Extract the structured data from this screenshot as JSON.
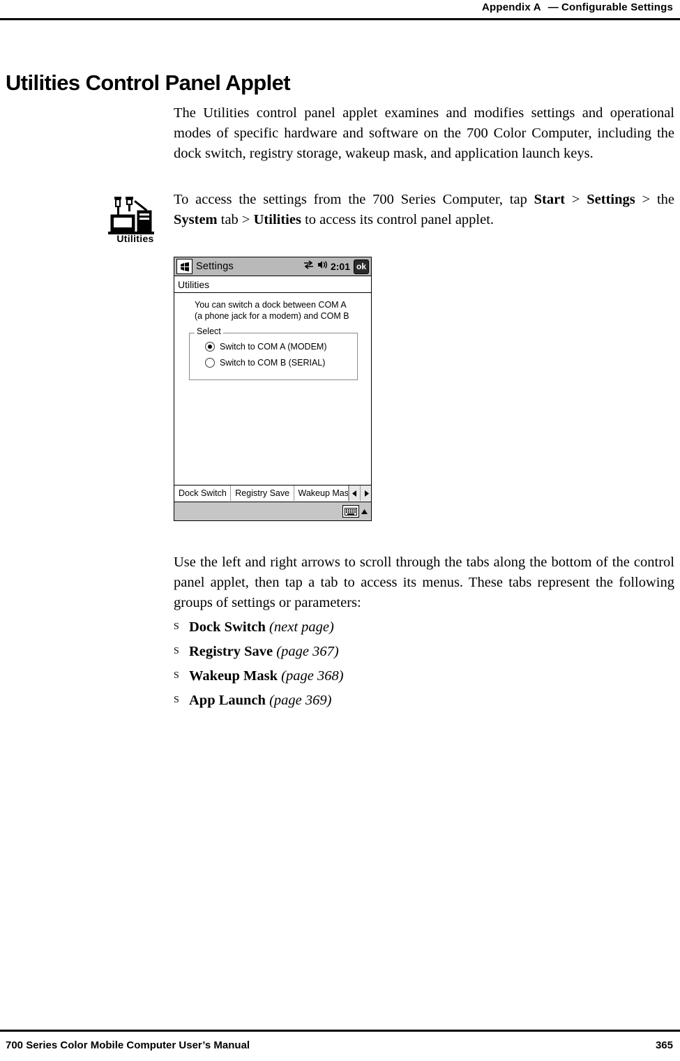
{
  "header": {
    "appendix": "Appendix A",
    "dash": "—",
    "section": "Configurable Settings"
  },
  "title": "Utilities Control Panel Applet",
  "paragraphs": {
    "intro": "The Utilities control panel applet examines and modifies settings and operational modes of specific hardware and software on the 700 Color Computer, including the dock switch, registry storage, wakeup mask, and application launch keys.",
    "access_prefix": "To access the settings from the 700 Series Computer, tap ",
    "access_start": "Start",
    "access_gt1": " > ",
    "access_settings": "Settings",
    "access_mid": " > the ",
    "access_system": "System",
    "access_tab": " tab > ",
    "access_utilities": "Utilities",
    "access_suffix": " to access its control panel applet.",
    "usage": "Use the left and right arrows to scroll through the tabs along the bottom of the control panel applet, then tap a tab to access its menus. These tabs represent the following groups of settings or parameters:"
  },
  "utilities_icon": {
    "label": "Utilities"
  },
  "device": {
    "titlebar": {
      "start_icon": "windows-start-icon",
      "title": "Settings",
      "connectivity_icon": "connectivity-icon",
      "volume_icon": "speaker-icon",
      "time": "2:01",
      "ok_label": "ok"
    },
    "subtitle": "Utilities",
    "description_line1": "You can switch a dock between COM A",
    "description_line2": "(a phone jack for a modem) and COM B",
    "group_label": "Select",
    "options": [
      {
        "label": "Switch to COM A (MODEM)",
        "selected": true
      },
      {
        "label": "Switch to COM B (SERIAL)",
        "selected": false
      }
    ],
    "tabs": [
      {
        "label": "Dock Switch",
        "active": true
      },
      {
        "label": "Registry Save",
        "active": false
      },
      {
        "label": "Wakeup Mas",
        "active": false
      }
    ],
    "scroll_left_icon": "triangle-left-icon",
    "scroll_right_icon": "triangle-right-icon",
    "keyboard_icon": "keyboard-icon",
    "input_chevron_icon": "chevron-up-icon"
  },
  "bullets": [
    {
      "mark": "S",
      "name": "Dock Switch",
      "ref": "(next page)"
    },
    {
      "mark": "S",
      "name": "Registry Save",
      "ref": "(page 367)"
    },
    {
      "mark": "S",
      "name": "Wakeup Mask",
      "ref": "(page 368)"
    },
    {
      "mark": "S",
      "name": "App Launch",
      "ref": "(page 369)"
    }
  ],
  "footer": {
    "manual": "700 Series Color Mobile Computer User’s Manual",
    "page": "365"
  }
}
